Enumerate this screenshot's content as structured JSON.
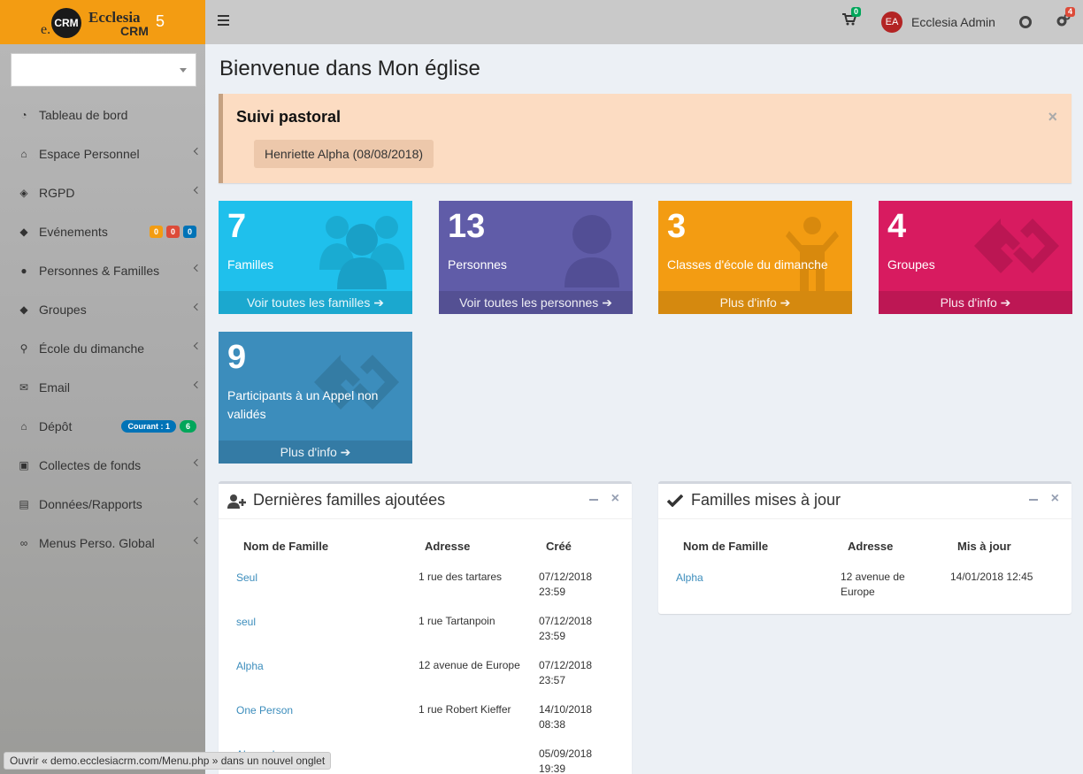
{
  "logo": {
    "mark": "CRM",
    "e": "e.",
    "name": "Ecclesia",
    "crm": "CRM",
    "version": "5"
  },
  "topbar": {
    "cart_count": "0",
    "avatar_initials": "EA",
    "user_name": "Ecclesia Admin",
    "settings_count": "4"
  },
  "sidebar": {
    "items": [
      {
        "label": "Tableau de bord",
        "icon": "dashboard-icon"
      },
      {
        "label": "Espace Personnel",
        "icon": "home-icon"
      },
      {
        "label": "RGPD",
        "icon": "shield-icon"
      },
      {
        "label": "Evénements",
        "icon": "ticket-icon",
        "badges": [
          "0",
          "0",
          "0"
        ]
      },
      {
        "label": "Personnes & Familles",
        "icon": "users-icon"
      },
      {
        "label": "Groupes",
        "icon": "tag-icon"
      },
      {
        "label": "École du dimanche",
        "icon": "child-icon"
      },
      {
        "label": "Email",
        "icon": "envelope-icon"
      },
      {
        "label": "Dépôt",
        "icon": "bank-icon",
        "badges": [
          "Courant : 1",
          "6"
        ]
      },
      {
        "label": "Collectes de fonds",
        "icon": "money-icon"
      },
      {
        "label": "Données/Rapports",
        "icon": "file-pdf-icon"
      },
      {
        "label": "Menus Perso. Global",
        "icon": "link-icon"
      }
    ]
  },
  "main": {
    "title": "Bienvenue dans Mon église",
    "callout": {
      "title": "Suivi pastoral",
      "chip": "Henriette Alpha (08/08/2018)",
      "close": "×"
    },
    "boxes": [
      {
        "number": "7",
        "label": "Familles",
        "footer": "Voir toutes les familles",
        "color": "#1fc0ec"
      },
      {
        "number": "13",
        "label": "Personnes",
        "footer": "Voir toutes les personnes",
        "color": "#605ca8"
      },
      {
        "number": "3",
        "label": "Classes d'école du dimanche",
        "footer": "Plus d'info",
        "color": "#f39c12"
      },
      {
        "number": "4",
        "label": "Groupes",
        "footer": "Plus d'info",
        "color": "#d81b60"
      },
      {
        "number": "9",
        "label": "Participants à un Appel non validés",
        "footer": "Plus d'info",
        "color": "#3c8dbc"
      }
    ],
    "latest": {
      "title": "Dernières familles ajoutées",
      "headers": [
        "Nom de Famille",
        "Adresse",
        "Créé"
      ],
      "rows": [
        {
          "name": "Seul",
          "address": "1 rue des tartares",
          "date": "07/12/2018",
          "time": "23:59"
        },
        {
          "name": "seul",
          "address": "1 rue Tartanpoin",
          "date": "07/12/2018",
          "time": "23:59"
        },
        {
          "name": "Alpha",
          "address": "12 avenue de Europe",
          "date": "07/12/2018",
          "time": "23:57"
        },
        {
          "name": "One Person",
          "address": "1 rue Robert Kieffer",
          "date": "14/10/2018",
          "time": "08:38"
        },
        {
          "name": "Alexander",
          "address": "",
          "date": "05/09/2018",
          "time": "19:39"
        }
      ]
    },
    "updated": {
      "title": "Familles mises à jour",
      "headers": [
        "Nom de Famille",
        "Adresse",
        "Mis à jour"
      ],
      "rows": [
        {
          "name": "Alpha",
          "address1": "12 avenue de",
          "address2": "Europe",
          "date": "14/01/2018 12:45"
        }
      ]
    }
  },
  "statusbar": "Ouvrir « demo.ecclesiacrm.com/Menu.php » dans un nouvel onglet",
  "colors": {
    "accent": "#f39c12",
    "sidebar": "#b0b0b0",
    "link": "#3c8dbc"
  }
}
